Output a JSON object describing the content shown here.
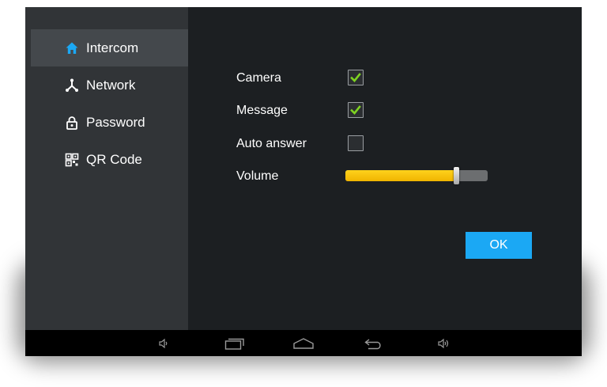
{
  "sidebar": {
    "items": [
      {
        "label": "Intercom",
        "icon": "home-icon",
        "active": true
      },
      {
        "label": "Network",
        "icon": "network-icon",
        "active": false
      },
      {
        "label": "Password",
        "icon": "lock-icon",
        "active": false
      },
      {
        "label": "QR Code",
        "icon": "qr-code-icon",
        "active": false
      }
    ]
  },
  "settings": {
    "camera": {
      "label": "Camera",
      "checked": true
    },
    "message": {
      "label": "Message",
      "checked": true
    },
    "auto_answer": {
      "label": "Auto answer",
      "checked": false
    },
    "volume": {
      "label": "Volume",
      "level_percent": 78
    }
  },
  "ok_label": "OK",
  "navbar": {
    "buttons": [
      "volume-down-icon",
      "recent-apps-icon",
      "home-icon",
      "back-icon",
      "volume-up-icon"
    ]
  },
  "colors": {
    "accent": "#1ba8f4",
    "check": "#7ed321",
    "slider_fill": "#f7c30c",
    "sidebar_bg": "#313437",
    "content_bg": "#1c1f22"
  }
}
